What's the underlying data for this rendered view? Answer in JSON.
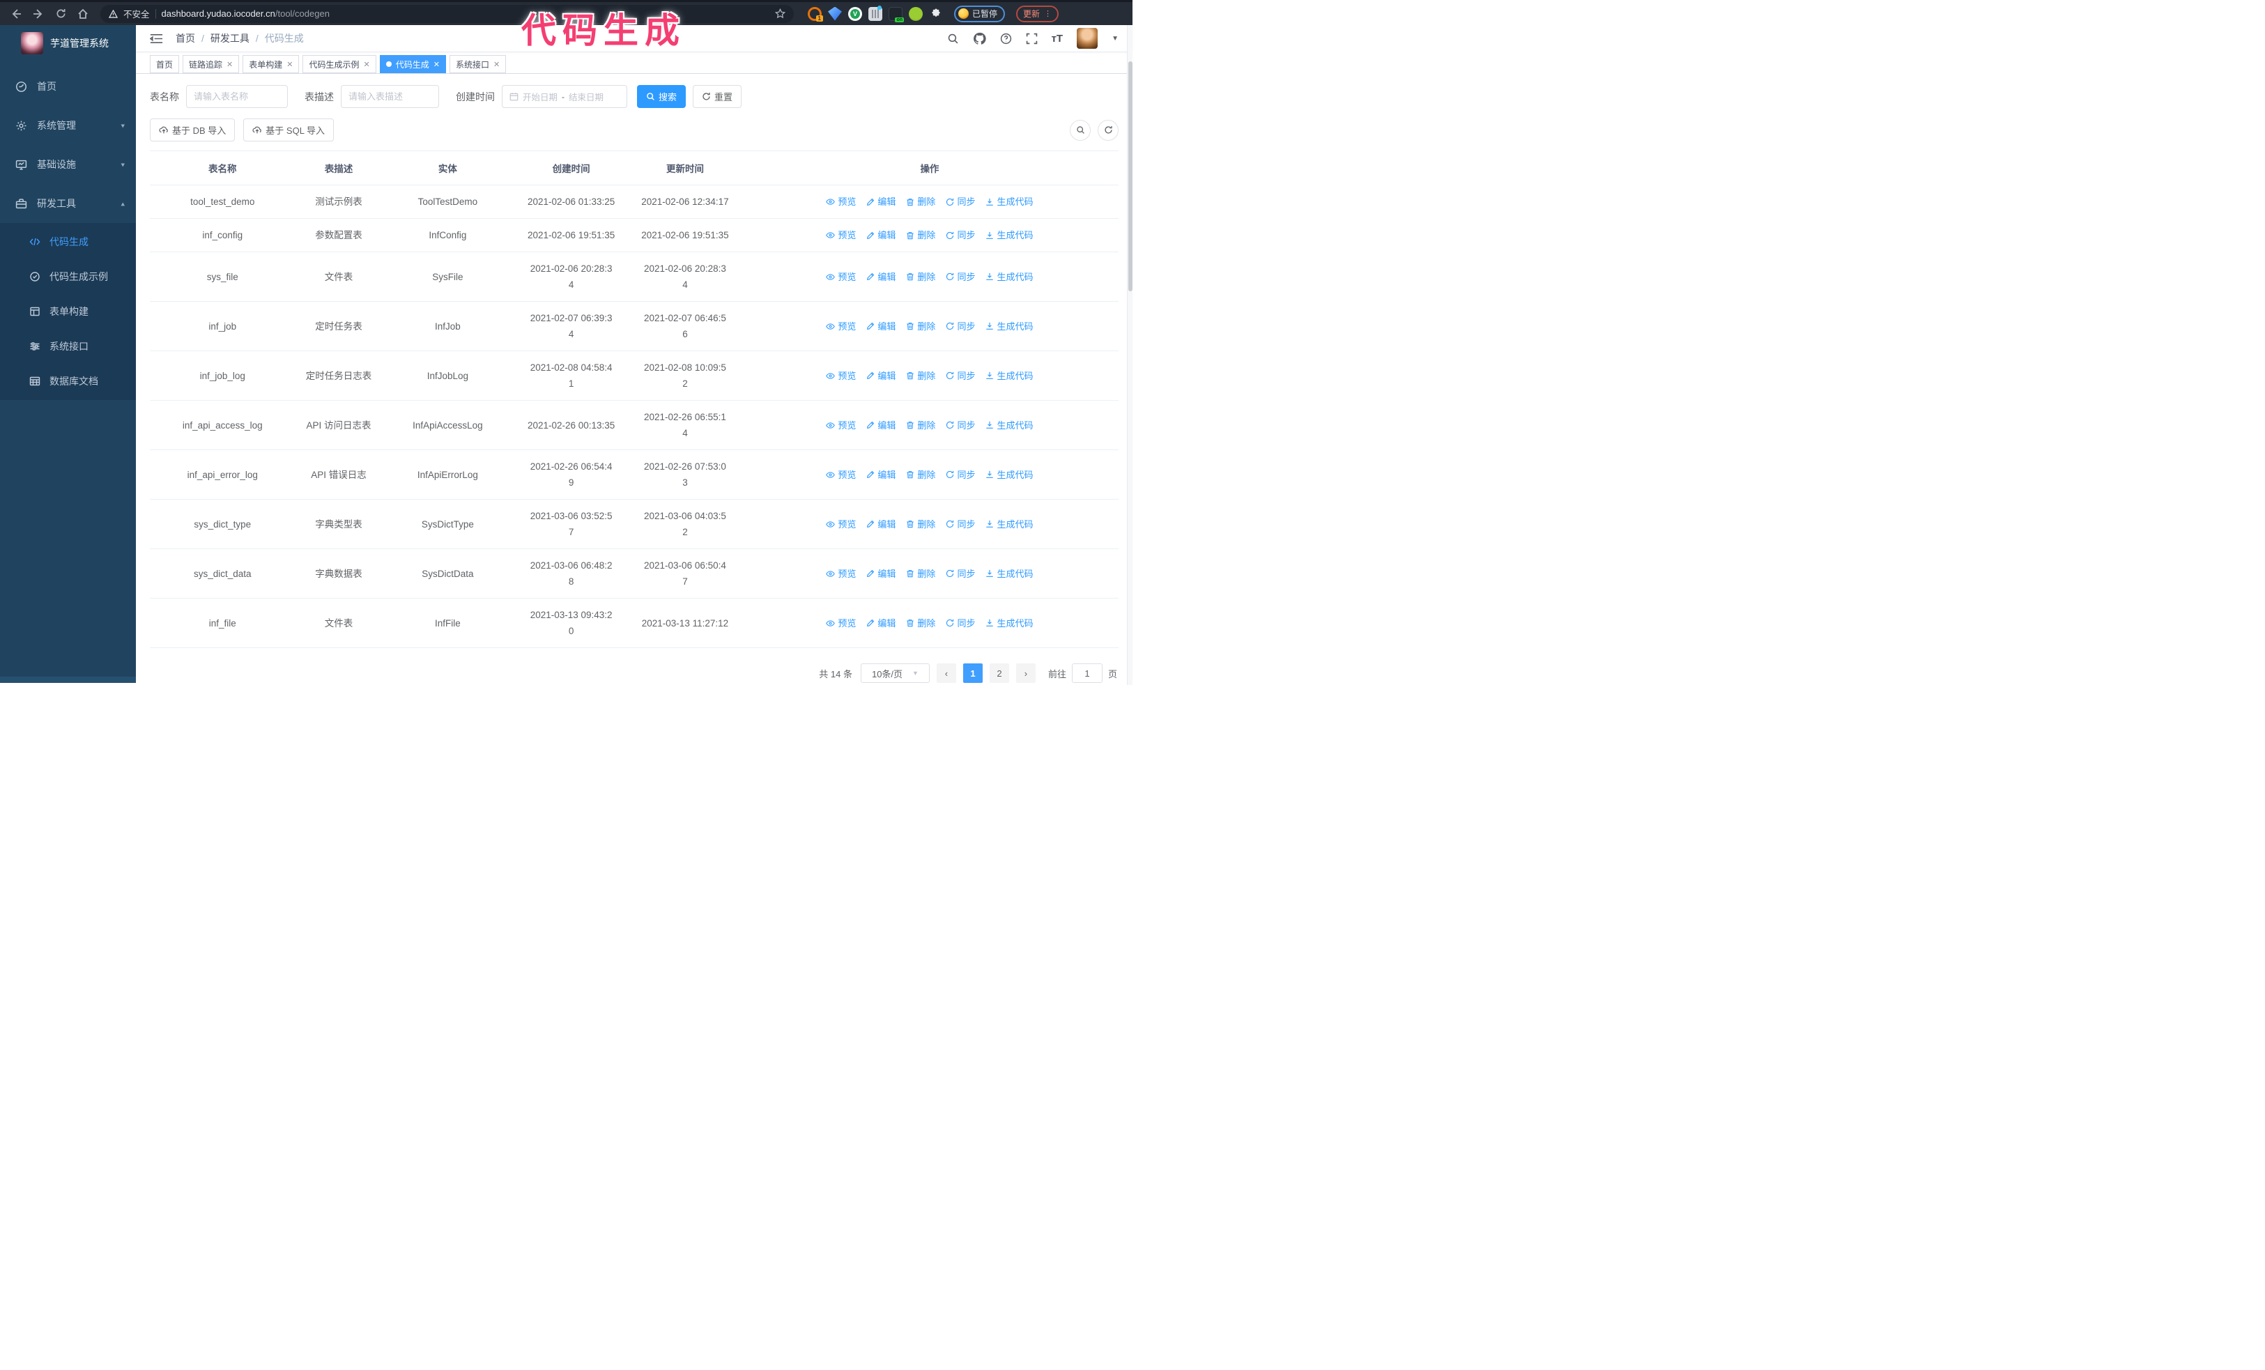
{
  "browser": {
    "security_label": "不安全",
    "url_host": "dashboard.yudao.iocoder.cn",
    "url_path": "/tool/codegen",
    "extension_badge": "1",
    "extension_on_label": "on",
    "paused_label": "已暂停",
    "update_label": "更新"
  },
  "annotation": {
    "text": "代码生成",
    "color": "#f43e71"
  },
  "sidebar": {
    "title": "芋道管理系统",
    "items": [
      {
        "label": "首页"
      },
      {
        "label": "系统管理"
      },
      {
        "label": "基础设施"
      },
      {
        "label": "研发工具"
      }
    ],
    "submenu": [
      {
        "label": "代码生成",
        "active": true
      },
      {
        "label": "代码生成示例",
        "active": false
      },
      {
        "label": "表单构建",
        "active": false
      },
      {
        "label": "系统接口",
        "active": false
      },
      {
        "label": "数据库文档",
        "active": false
      }
    ]
  },
  "header": {
    "breadcrumb": [
      "首页",
      "研发工具",
      "代码生成"
    ]
  },
  "tabs": [
    {
      "label": "首页",
      "closable": false,
      "active": false
    },
    {
      "label": "链路追踪",
      "closable": true,
      "active": false
    },
    {
      "label": "表单构建",
      "closable": true,
      "active": false
    },
    {
      "label": "代码生成示例",
      "closable": true,
      "active": false
    },
    {
      "label": "代码生成",
      "closable": true,
      "active": true
    },
    {
      "label": "系统接口",
      "closable": true,
      "active": false
    }
  ],
  "filters": {
    "table_name_label": "表名称",
    "table_name_placeholder": "请输入表名称",
    "table_desc_label": "表描述",
    "table_desc_placeholder": "请输入表描述",
    "create_time_label": "创建时间",
    "date_start_placeholder": "开始日期",
    "date_separator": "-",
    "date_end_placeholder": "结束日期",
    "search_label": "搜索",
    "reset_label": "重置"
  },
  "toolbar": {
    "import_db_label": "基于 DB 导入",
    "import_sql_label": "基于 SQL 导入"
  },
  "table": {
    "columns": [
      "表名称",
      "表描述",
      "实体",
      "创建时间",
      "更新时间",
      "操作"
    ],
    "actions": [
      "预览",
      "编辑",
      "删除",
      "同步",
      "生成代码"
    ],
    "rows": [
      {
        "name": "tool_test_demo",
        "desc": "测试示例表",
        "entity": "ToolTestDemo",
        "created": "2021-02-06 01:33:25",
        "updated": "2021-02-06 12:34:17"
      },
      {
        "name": "inf_config",
        "desc": "参数配置表",
        "entity": "InfConfig",
        "created": "2021-02-06 19:51:35",
        "updated": "2021-02-06 19:51:35"
      },
      {
        "name": "sys_file",
        "desc": "文件表",
        "entity": "SysFile",
        "created": "2021-02-06 20:28:3\n4",
        "updated": "2021-02-06 20:28:3\n4"
      },
      {
        "name": "inf_job",
        "desc": "定时任务表",
        "entity": "InfJob",
        "created": "2021-02-07 06:39:3\n4",
        "updated": "2021-02-07 06:46:5\n6"
      },
      {
        "name": "inf_job_log",
        "desc": "定时任务日志表",
        "entity": "InfJobLog",
        "created": "2021-02-08 04:58:4\n1",
        "updated": "2021-02-08 10:09:5\n2"
      },
      {
        "name": "inf_api_access_log",
        "desc": "API 访问日志表",
        "entity": "InfApiAccessLog",
        "created": "2021-02-26 00:13:35",
        "updated": "2021-02-26 06:55:1\n4"
      },
      {
        "name": "inf_api_error_log",
        "desc": "API 错误日志",
        "entity": "InfApiErrorLog",
        "created": "2021-02-26 06:54:4\n9",
        "updated": "2021-02-26 07:53:0\n3"
      },
      {
        "name": "sys_dict_type",
        "desc": "字典类型表",
        "entity": "SysDictType",
        "created": "2021-03-06 03:52:5\n7",
        "updated": "2021-03-06 04:03:5\n2"
      },
      {
        "name": "sys_dict_data",
        "desc": "字典数据表",
        "entity": "SysDictData",
        "created": "2021-03-06 06:48:2\n8",
        "updated": "2021-03-06 06:50:4\n7"
      },
      {
        "name": "inf_file",
        "desc": "文件表",
        "entity": "InfFile",
        "created": "2021-03-13 09:43:2\n0",
        "updated": "2021-03-13 11:27:12"
      }
    ]
  },
  "pagination": {
    "total": "共 14 条",
    "page_size": "10条/页",
    "pages": [
      "1",
      "2"
    ],
    "active_page": "1",
    "goto_label": "前往",
    "goto_value": "1",
    "goto_suffix": "页"
  }
}
